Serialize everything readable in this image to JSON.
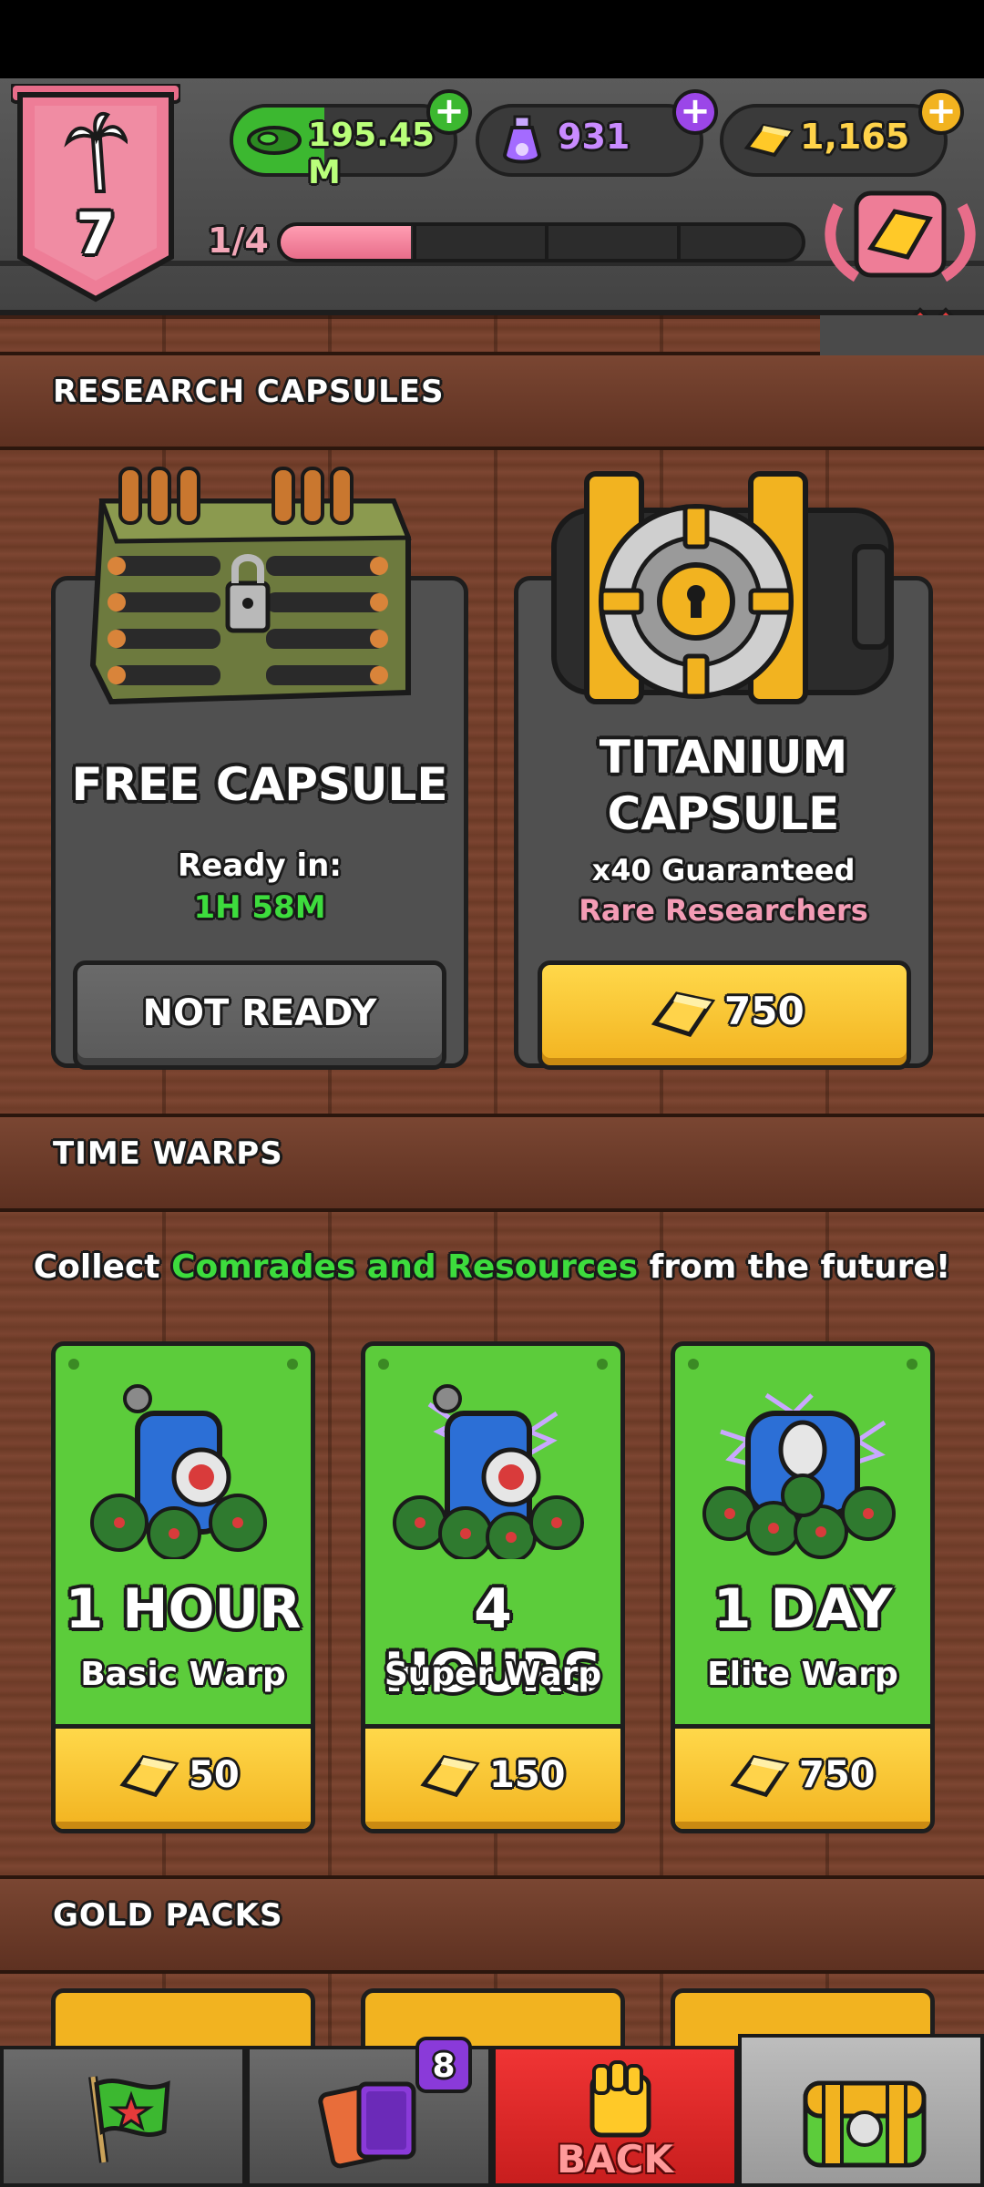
{
  "header": {
    "level": "7",
    "cash": "195.45 M",
    "potion": "931",
    "gold": "1,165",
    "progress_label": "1/4",
    "progress_fraction": 0.25
  },
  "research": {
    "title": "RESEARCH CAPSULES",
    "free": {
      "name": "FREE CAPSULE",
      "ready_label": "Ready in:",
      "timer": "1H 58M",
      "button": "NOT READY"
    },
    "titanium": {
      "name_line1": "TITANIUM",
      "name_line2": "CAPSULE",
      "desc_line1": "x40 Guaranteed",
      "desc_line2": "Rare Researchers",
      "price": "750"
    }
  },
  "time_warps": {
    "title": "TIME WARPS",
    "subtitle_a": "Collect",
    "subtitle_b": "Comrades and Resources",
    "subtitle_c": "from the future!",
    "items": [
      {
        "duration": "1 HOUR",
        "name": "Basic Warp",
        "price": "50"
      },
      {
        "duration": "4 HOURS",
        "name": "Super Warp",
        "price": "150"
      },
      {
        "duration": "1 DAY",
        "name": "Elite Warp",
        "price": "750"
      }
    ]
  },
  "gold_packs": {
    "title": "GOLD PACKS"
  },
  "bottom_nav": {
    "cards_badge": "8",
    "back_label": "BACK"
  },
  "colors": {
    "accent_green": "#5ccc3b",
    "gold": "#f2b320",
    "pink": "#e86d8a",
    "timer_green": "#3ddc3d"
  }
}
